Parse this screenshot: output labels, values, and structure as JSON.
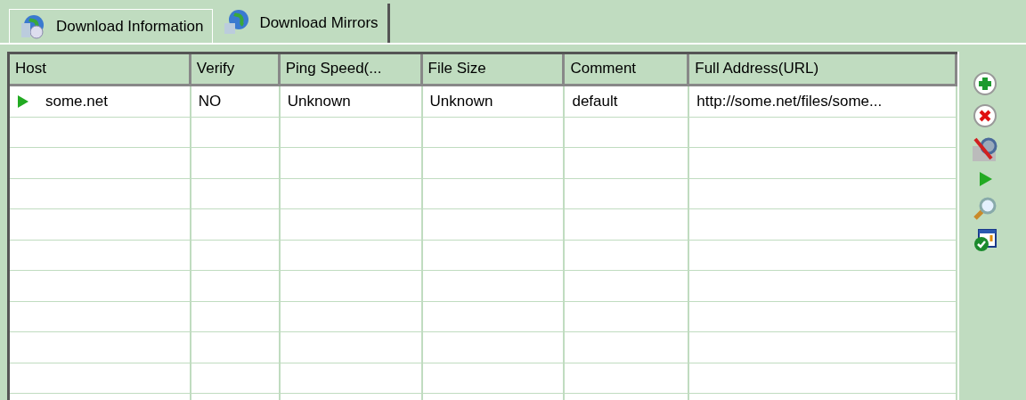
{
  "tabs": [
    {
      "label": "Download Information",
      "selected": false
    },
    {
      "label": "Download Mirrors",
      "selected": true
    }
  ],
  "table": {
    "columns": [
      "Host",
      "Verify",
      "Ping Speed(...",
      "File Size",
      "Comment",
      "Full Address(URL)"
    ],
    "rows": [
      {
        "cells": [
          "some.net",
          "NO",
          "Unknown",
          "Unknown",
          "default",
          "http://some.net/files/some..."
        ]
      }
    ]
  }
}
